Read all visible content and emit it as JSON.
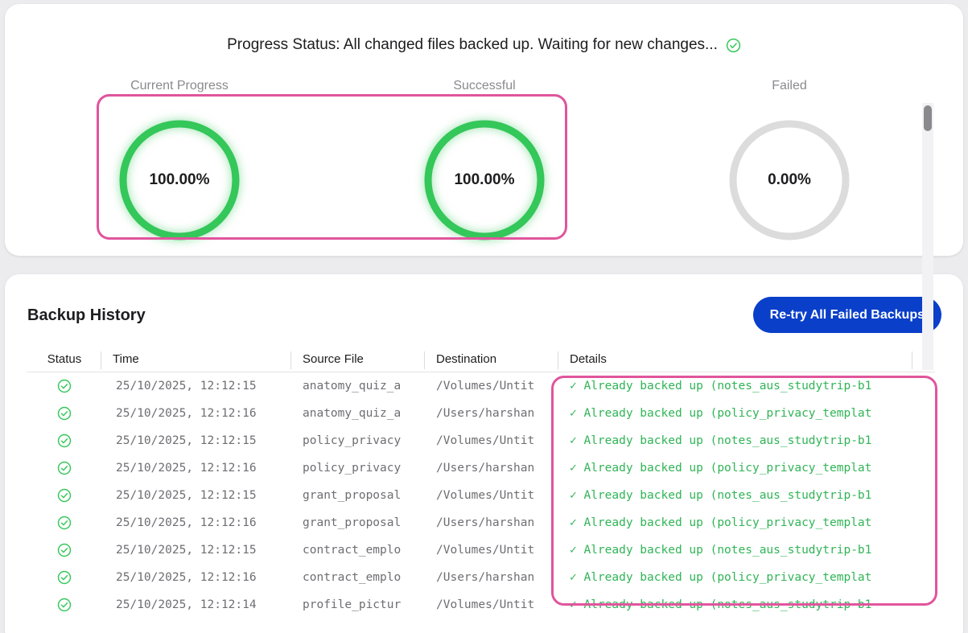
{
  "progress": {
    "status_text": "Progress Status: All changed files backed up. Waiting for new changes...",
    "metrics": [
      {
        "label": "Current Progress",
        "value_text": "100.00%",
        "fraction": 1.0,
        "color": "#34c759"
      },
      {
        "label": "Successful",
        "value_text": "100.00%",
        "fraction": 1.0,
        "color": "#34c759"
      },
      {
        "label": "Failed",
        "value_text": "0.00%",
        "fraction": 0.0,
        "color": "#dcdcdc"
      }
    ]
  },
  "history": {
    "title": "Backup History",
    "retry_button": "Re-try All Failed Backups",
    "columns": [
      "Status",
      "Time",
      "Source File",
      "Destination",
      "Details"
    ],
    "rows": [
      {
        "status": "success",
        "time": "25/10/2025, 12:12:15 ",
        "source": "anatomy_quiz_a",
        "destination": "/Volumes/Untit",
        "details": "✓ Already backed up (notes_aus_studytrip-b1"
      },
      {
        "status": "success",
        "time": "25/10/2025, 12:12:16 ",
        "source": "anatomy_quiz_a",
        "destination": "/Users/harshan",
        "details": "✓ Already backed up (policy_privacy_templat"
      },
      {
        "status": "success",
        "time": "25/10/2025, 12:12:15 ",
        "source": "policy_privacy",
        "destination": "/Volumes/Untit",
        "details": "✓ Already backed up (notes_aus_studytrip-b1"
      },
      {
        "status": "success",
        "time": "25/10/2025, 12:12:16 ",
        "source": "policy_privacy",
        "destination": "/Users/harshan",
        "details": "✓ Already backed up (policy_privacy_templat"
      },
      {
        "status": "success",
        "time": "25/10/2025, 12:12:15 ",
        "source": "grant_proposal",
        "destination": "/Volumes/Untit",
        "details": "✓ Already backed up (notes_aus_studytrip-b1"
      },
      {
        "status": "success",
        "time": "25/10/2025, 12:12:16 ",
        "source": "grant_proposal",
        "destination": "/Users/harshan",
        "details": "✓ Already backed up (policy_privacy_templat"
      },
      {
        "status": "success",
        "time": "25/10/2025, 12:12:15 ",
        "source": "contract_emplo",
        "destination": "/Volumes/Untit",
        "details": "✓ Already backed up (notes_aus_studytrip-b1"
      },
      {
        "status": "success",
        "time": "25/10/2025, 12:12:16 ",
        "source": "contract_emplo",
        "destination": "/Users/harshan",
        "details": "✓ Already backed up (policy_privacy_templat"
      },
      {
        "status": "success",
        "time": "25/10/2025, 12:12:14 ",
        "source": "profile_pictur",
        "destination": "/Volumes/Untit",
        "details": "✓ Already backed up (notes_aus_studytrip-b1"
      }
    ]
  },
  "icons": {
    "status_check": "check-circle-icon"
  }
}
